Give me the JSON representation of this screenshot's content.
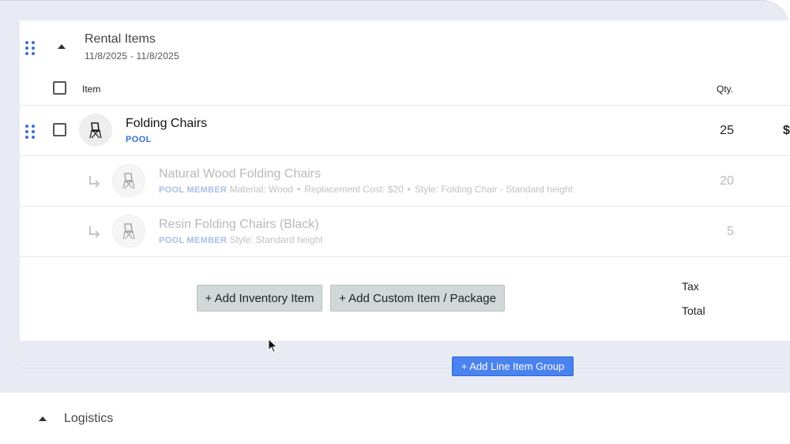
{
  "group": {
    "title": "Rental Items",
    "dates": "11/8/2025 - 11/8/2025"
  },
  "table_header": {
    "item_label": "Item",
    "qty_label": "Qty."
  },
  "pool_item": {
    "name": "Folding Chairs",
    "tag": "POOL",
    "qty": "25",
    "price_partial": "$",
    "icon": "folding-chair-icon"
  },
  "members": [
    {
      "name": "Natural Wood Folding Chairs",
      "tag": "POOL MEMBER",
      "attrs": [
        "Material: Wood",
        "Replacement Cost: $20",
        "Style: Folding Chair - Standard height"
      ],
      "qty": "20"
    },
    {
      "name": "Resin Folding Chairs (Black)",
      "tag": "POOL MEMBER",
      "attrs": [
        "Style: Standard height"
      ],
      "qty": "5"
    }
  ],
  "actions": {
    "add_inventory": "+ Add Inventory Item",
    "add_custom": "+ Add Custom Item / Package",
    "add_group": "+ Add Line Item Group"
  },
  "totals": {
    "tax_label": "Tax",
    "total_label": "Total"
  },
  "logistics": {
    "title": "Logistics"
  },
  "colors": {
    "accent_blue": "#3b6fd6",
    "button_blue": "#4a82f0",
    "button_gray": "#d2d8d8",
    "page_bg": "#e8ebf3"
  }
}
